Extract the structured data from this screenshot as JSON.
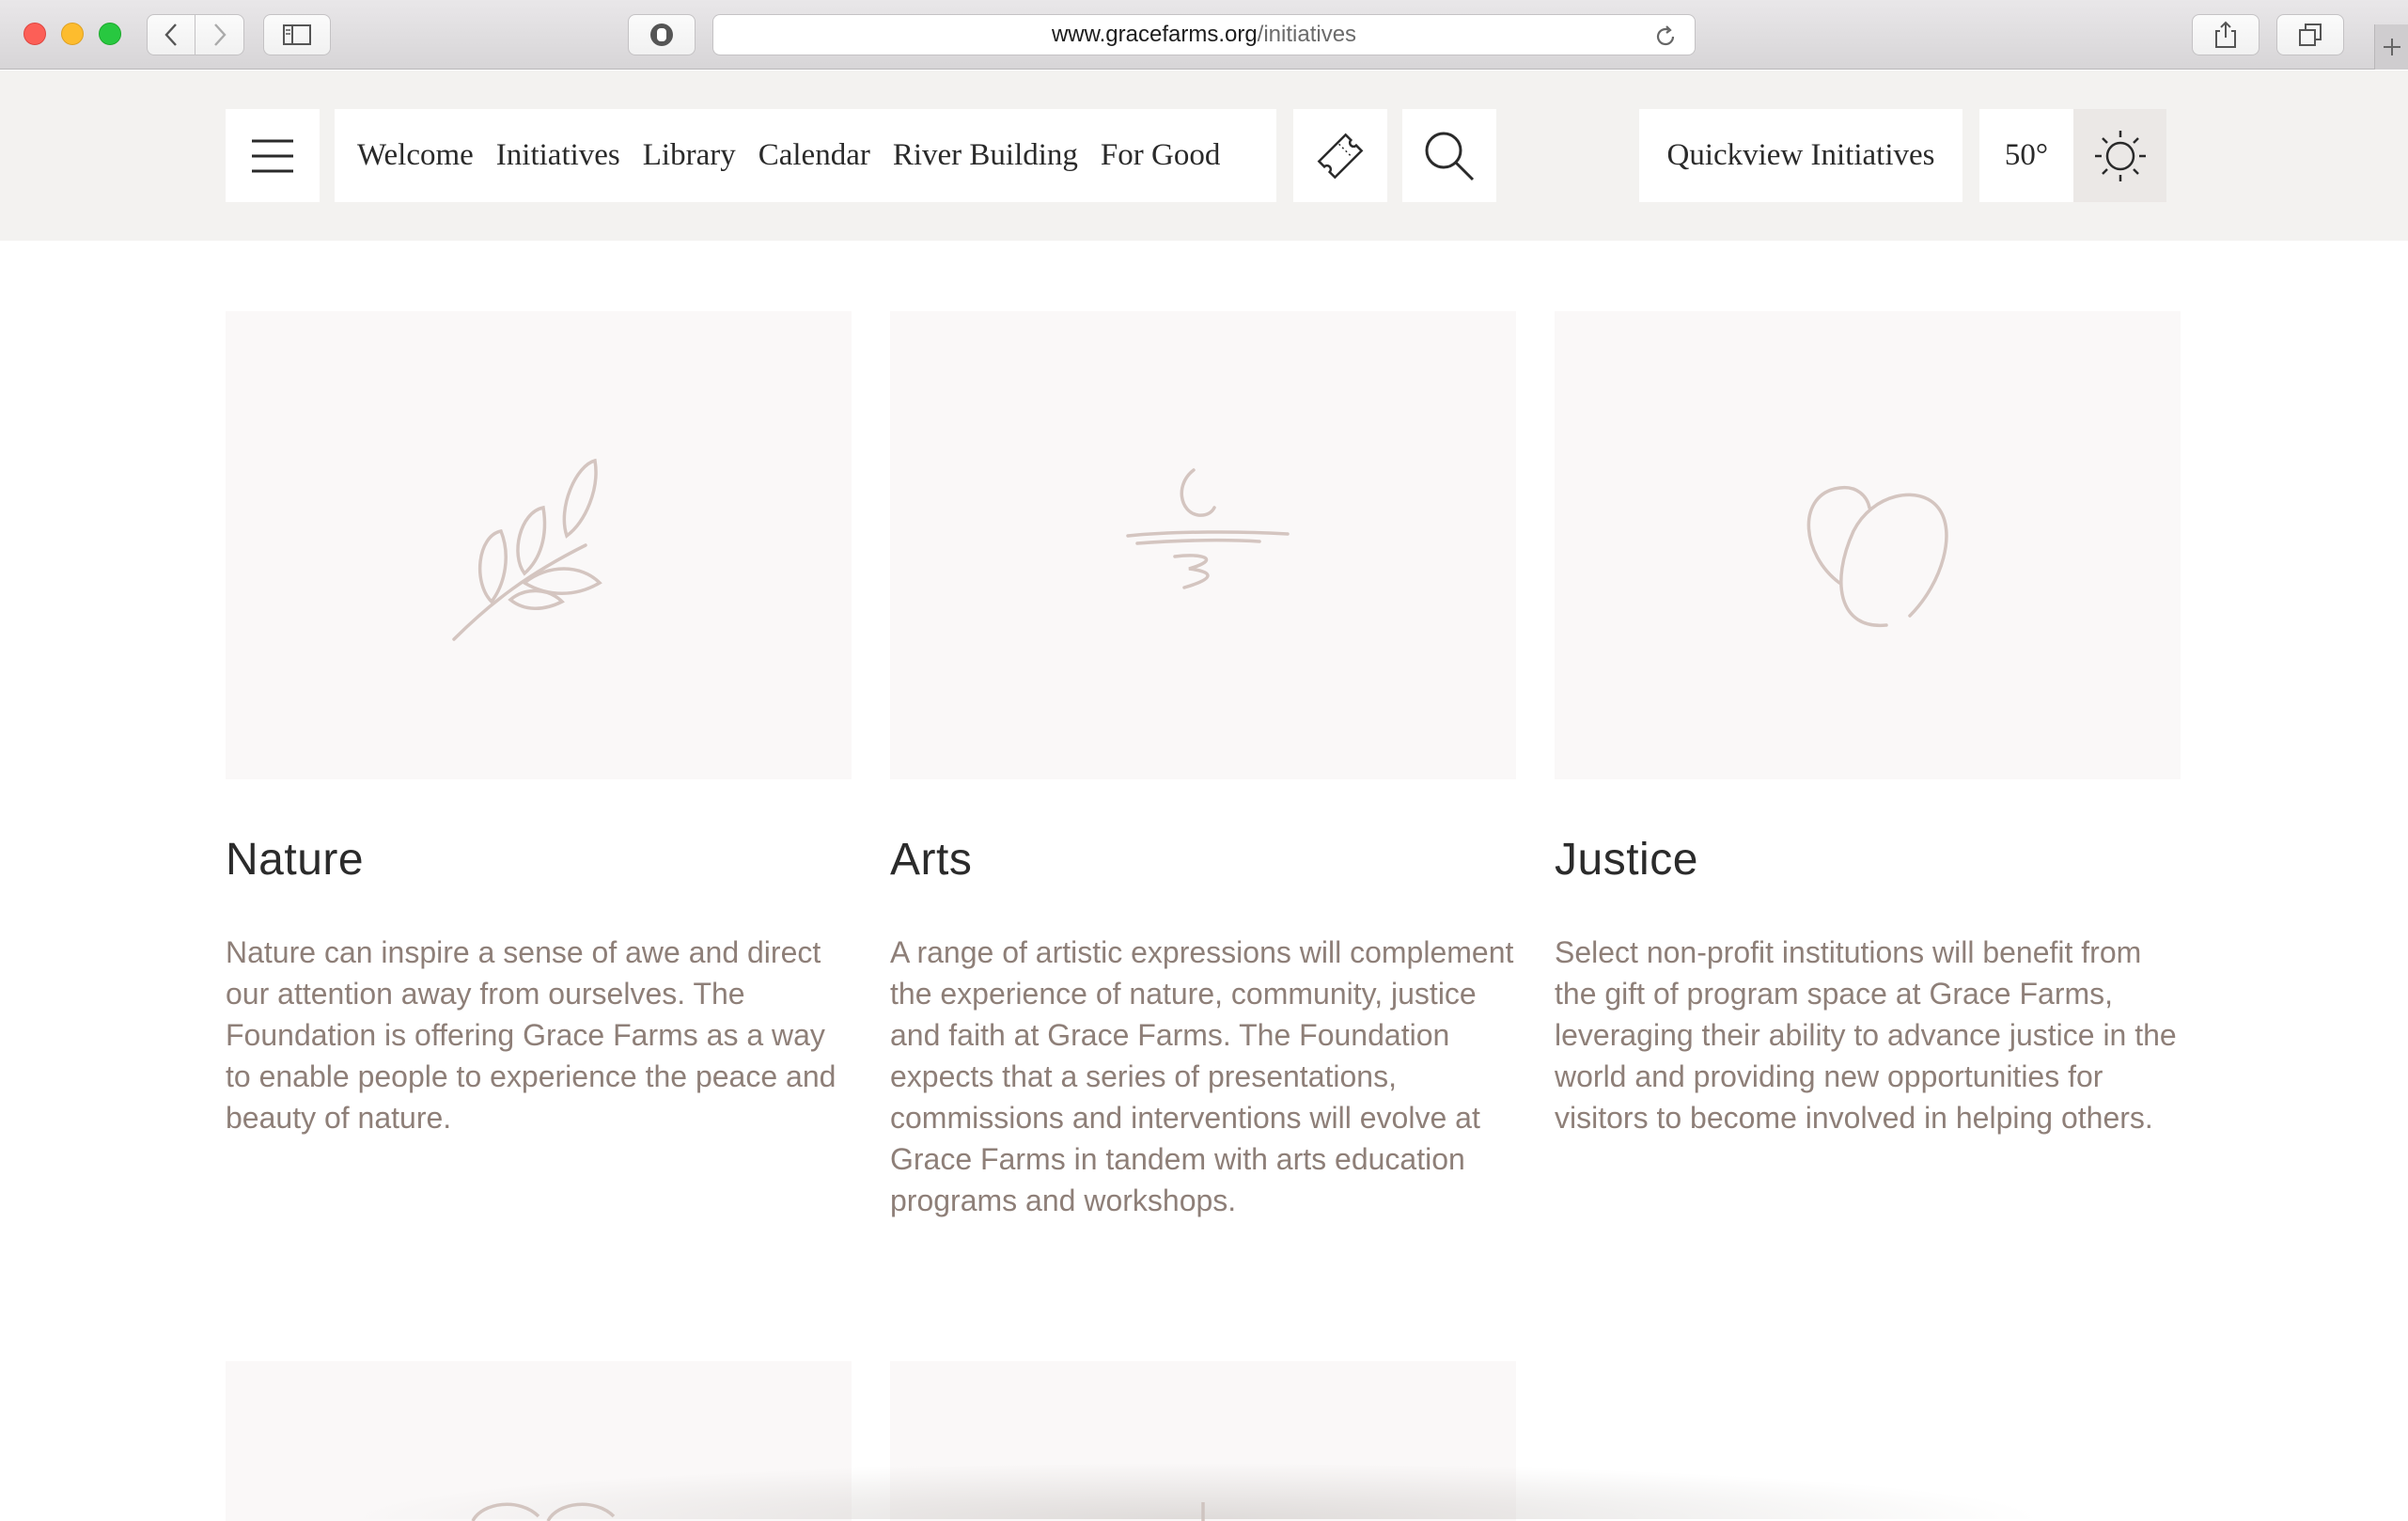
{
  "browser": {
    "url_host": "www.gracefarms.org",
    "url_path": "/initiatives",
    "icons": [
      "back-icon",
      "forward-icon",
      "sidebar-icon",
      "privacy-icon",
      "reload-icon",
      "share-icon",
      "tabs-icon",
      "new-tab-icon"
    ]
  },
  "header": {
    "nav": [
      "Welcome",
      "Initiatives",
      "Library",
      "Calendar",
      "River Building",
      "For Good"
    ],
    "quickview_label": "Quickview Initiatives",
    "temperature": "50°",
    "icons": [
      "hamburger-menu-icon",
      "ticket-icon",
      "search-icon",
      "sun-icon"
    ]
  },
  "initiatives": [
    {
      "title": "Nature",
      "icon": "leaf-branch-icon",
      "description": "Nature can inspire a sense of awe and direct our attention away from ourselves. The Foundation is offering Grace Farms as a way to enable people to experience the peace and beauty of nature."
    },
    {
      "title": "Arts",
      "icon": "arts-brush-icon",
      "description": "A range of artistic expressions will complement the experience of nature, community, justice and faith at Grace Farms. The Foundation expects that a series of presentations, commissions and interventions will evolve at Grace Farms in tandem with arts education programs and workshops."
    },
    {
      "title": "Justice",
      "icon": "justice-circles-icon",
      "description": "Select non-profit institutions will benefit from the gift of program space at Grace Farms, leveraging their ability to advance justice in the world and providing new opportunities for visitors to become involved in helping others."
    }
  ],
  "colors": {
    "header_bg": "#f3f2f0",
    "card_bg": "#faf8f8",
    "icon_stroke": "#d4c5c0",
    "description_text": "#8e7f78"
  }
}
